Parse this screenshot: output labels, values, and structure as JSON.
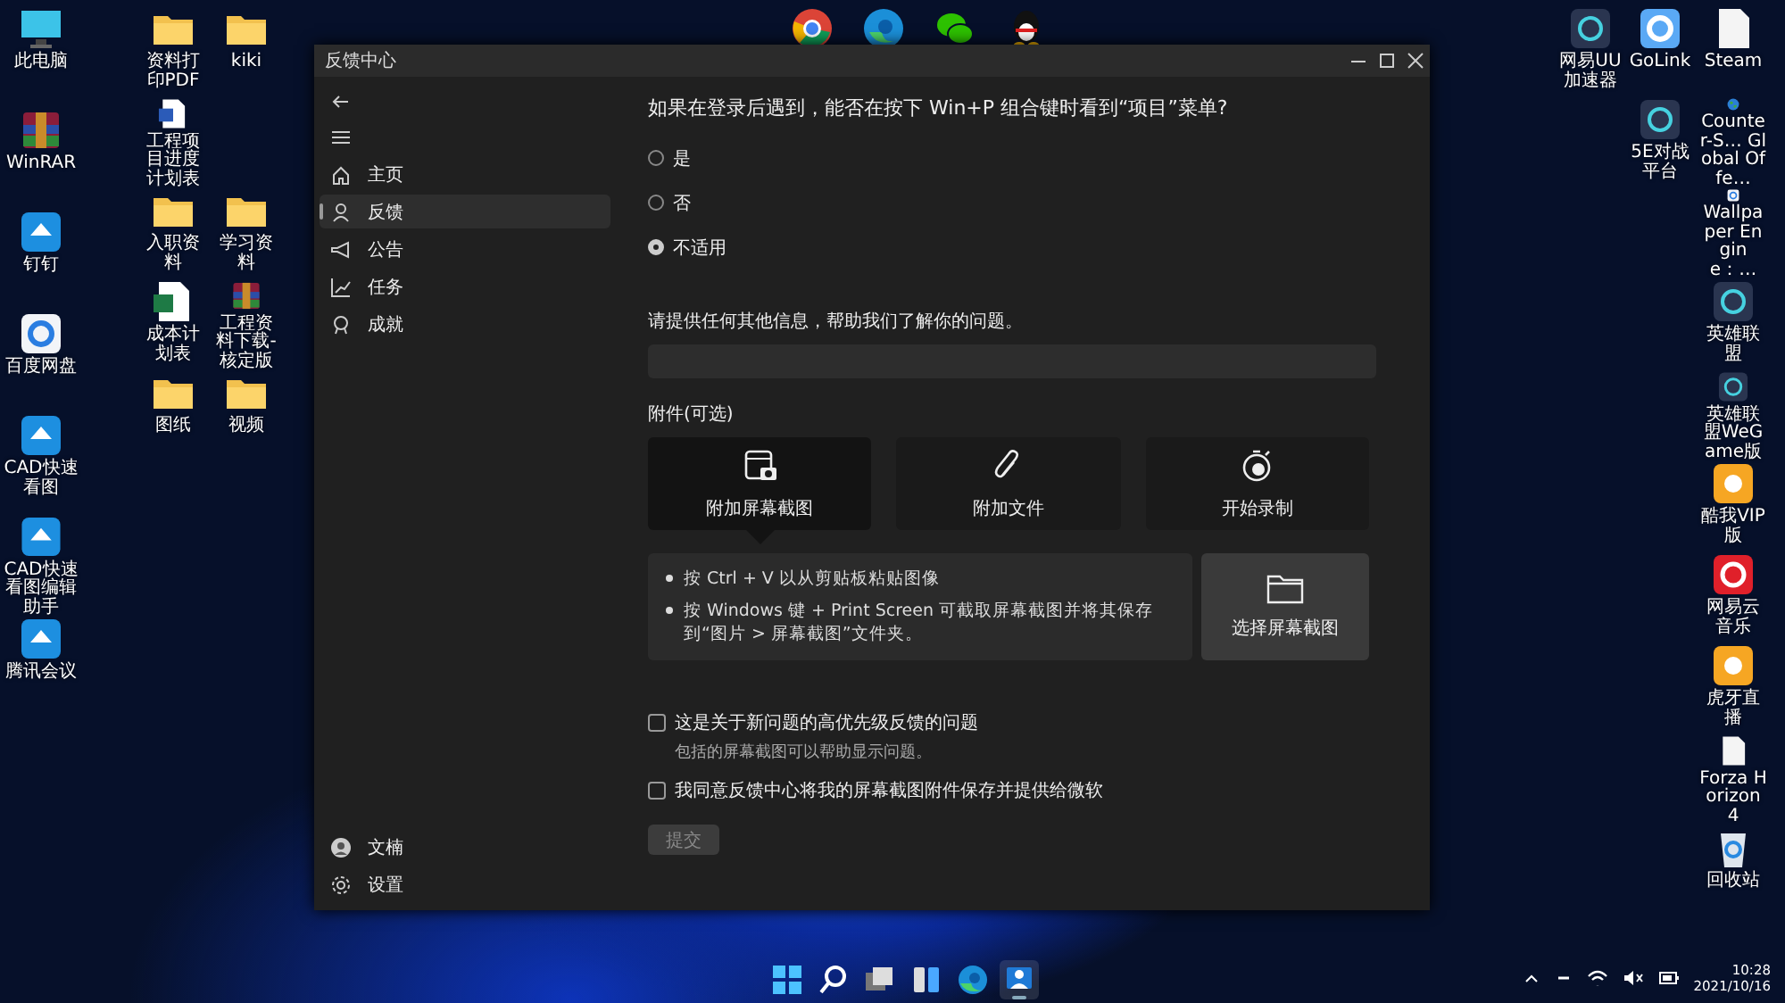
{
  "desktop": {
    "left_columns": [
      [
        {
          "label": "此电脑",
          "kind": "monitor"
        },
        {
          "label": "WinRAR",
          "kind": "archive"
        },
        {
          "label": "钉钉",
          "kind": "blue"
        },
        {
          "label": "百度网盘",
          "kind": "white"
        },
        {
          "label": "CAD快速看图",
          "kind": "blue"
        },
        {
          "label": "CAD快速看图编辑助手",
          "kind": "blue"
        },
        {
          "label": "腾讯会议",
          "kind": "blue"
        }
      ],
      [
        {
          "label": "资料打印PDF",
          "kind": "folder"
        },
        {
          "label": "工程项目进度计划表",
          "kind": "word"
        },
        {
          "label": "入职资料",
          "kind": "folder"
        },
        {
          "label": "成本计划表",
          "kind": "excel"
        },
        {
          "label": "图纸",
          "kind": "folder"
        }
      ],
      [
        {
          "label": "kiki",
          "kind": "folder"
        },
        {
          "label": "学习资料",
          "kind": "folder"
        },
        {
          "label": "工程资料下载-核定版",
          "kind": "archive"
        },
        {
          "label": "视频",
          "kind": "folder"
        }
      ]
    ],
    "top_apps": [
      {
        "kind": "chrome"
      },
      {
        "kind": "edge"
      },
      {
        "kind": "wechat"
      },
      {
        "kind": "qq"
      }
    ],
    "right_columns": [
      [
        {
          "label": "网易UU加速器",
          "kind": "dark"
        }
      ],
      [
        {
          "label": "GoLink",
          "kind": "lightblue"
        },
        {
          "label": "5E对战平台",
          "kind": "dark"
        }
      ],
      [
        {
          "label": "Steam",
          "kind": "file"
        },
        {
          "label": "Counter-S… Global Offe…",
          "kind": "globe"
        },
        {
          "label": "Wallpaper Engine：…",
          "kind": "white"
        },
        {
          "label": "英雄联盟",
          "kind": "dark"
        },
        {
          "label": "英雄联盟WeGame版",
          "kind": "dark"
        },
        {
          "label": "酷我VIP版",
          "kind": "orange"
        },
        {
          "label": "网易云音乐",
          "kind": "red"
        },
        {
          "label": "虎牙直播",
          "kind": "orange"
        },
        {
          "label": "Forza Horizon 4",
          "kind": "file"
        },
        {
          "label": "回收站",
          "kind": "recycle"
        }
      ]
    ]
  },
  "window": {
    "title": "反馈中心",
    "sidebar": {
      "items": [
        {
          "label": "主页",
          "kind": "home",
          "selected": false
        },
        {
          "label": "反馈",
          "kind": "feedback",
          "selected": true
        },
        {
          "label": "公告",
          "kind": "megaphone",
          "selected": false
        },
        {
          "label": "任务",
          "kind": "quest",
          "selected": false
        },
        {
          "label": "成就",
          "kind": "badge",
          "selected": false
        }
      ],
      "bottom_items": [
        {
          "label": "文楠",
          "kind": "avatar"
        },
        {
          "label": "设置",
          "kind": "gear"
        }
      ]
    },
    "question": "如果在登录后遇到，能否在按下 Win+P 组合键时看到“项目”菜单?",
    "options": [
      {
        "label": "是",
        "selected": false
      },
      {
        "label": "否",
        "selected": false
      },
      {
        "label": "不适用",
        "selected": true
      }
    ],
    "details_prompt": "请提供任何其他信息，帮助我们了解你的问题。",
    "attachments_heading": "附件(可选)",
    "attachment_tiles": [
      {
        "label": "附加屏幕截图",
        "kind": "screenshot",
        "selected": true
      },
      {
        "label": "附加文件",
        "kind": "clip",
        "selected": false
      },
      {
        "label": "开始录制",
        "kind": "record",
        "selected": false
      }
    ],
    "tips": [
      "按 Ctrl + V 以从剪贴板粘贴图像",
      "按 Windows 键 + Print Screen 可截取屏幕截图并将其保存到“图片 > 屏幕截图”文件夹。"
    ],
    "choose_screenshot": "选择屏幕截图",
    "checkboxes": [
      {
        "label": "这是关于新问题的高优先级反馈的问题",
        "note": "包括的屏幕截图可以帮助显示问题。",
        "checked": false
      },
      {
        "label": "我同意反馈中心将我的屏幕截图附件保存并提供给微软",
        "checked": false
      }
    ],
    "submit": "提交"
  },
  "taskbar": {
    "apps": [
      {
        "kind": "start",
        "active": false
      },
      {
        "kind": "search",
        "active": false
      },
      {
        "kind": "taskview",
        "active": false
      },
      {
        "kind": "widgets",
        "active": false
      },
      {
        "kind": "edge",
        "active": false
      },
      {
        "kind": "feedback",
        "active": true
      }
    ],
    "time": "10:28",
    "date": "2021/10/16"
  }
}
